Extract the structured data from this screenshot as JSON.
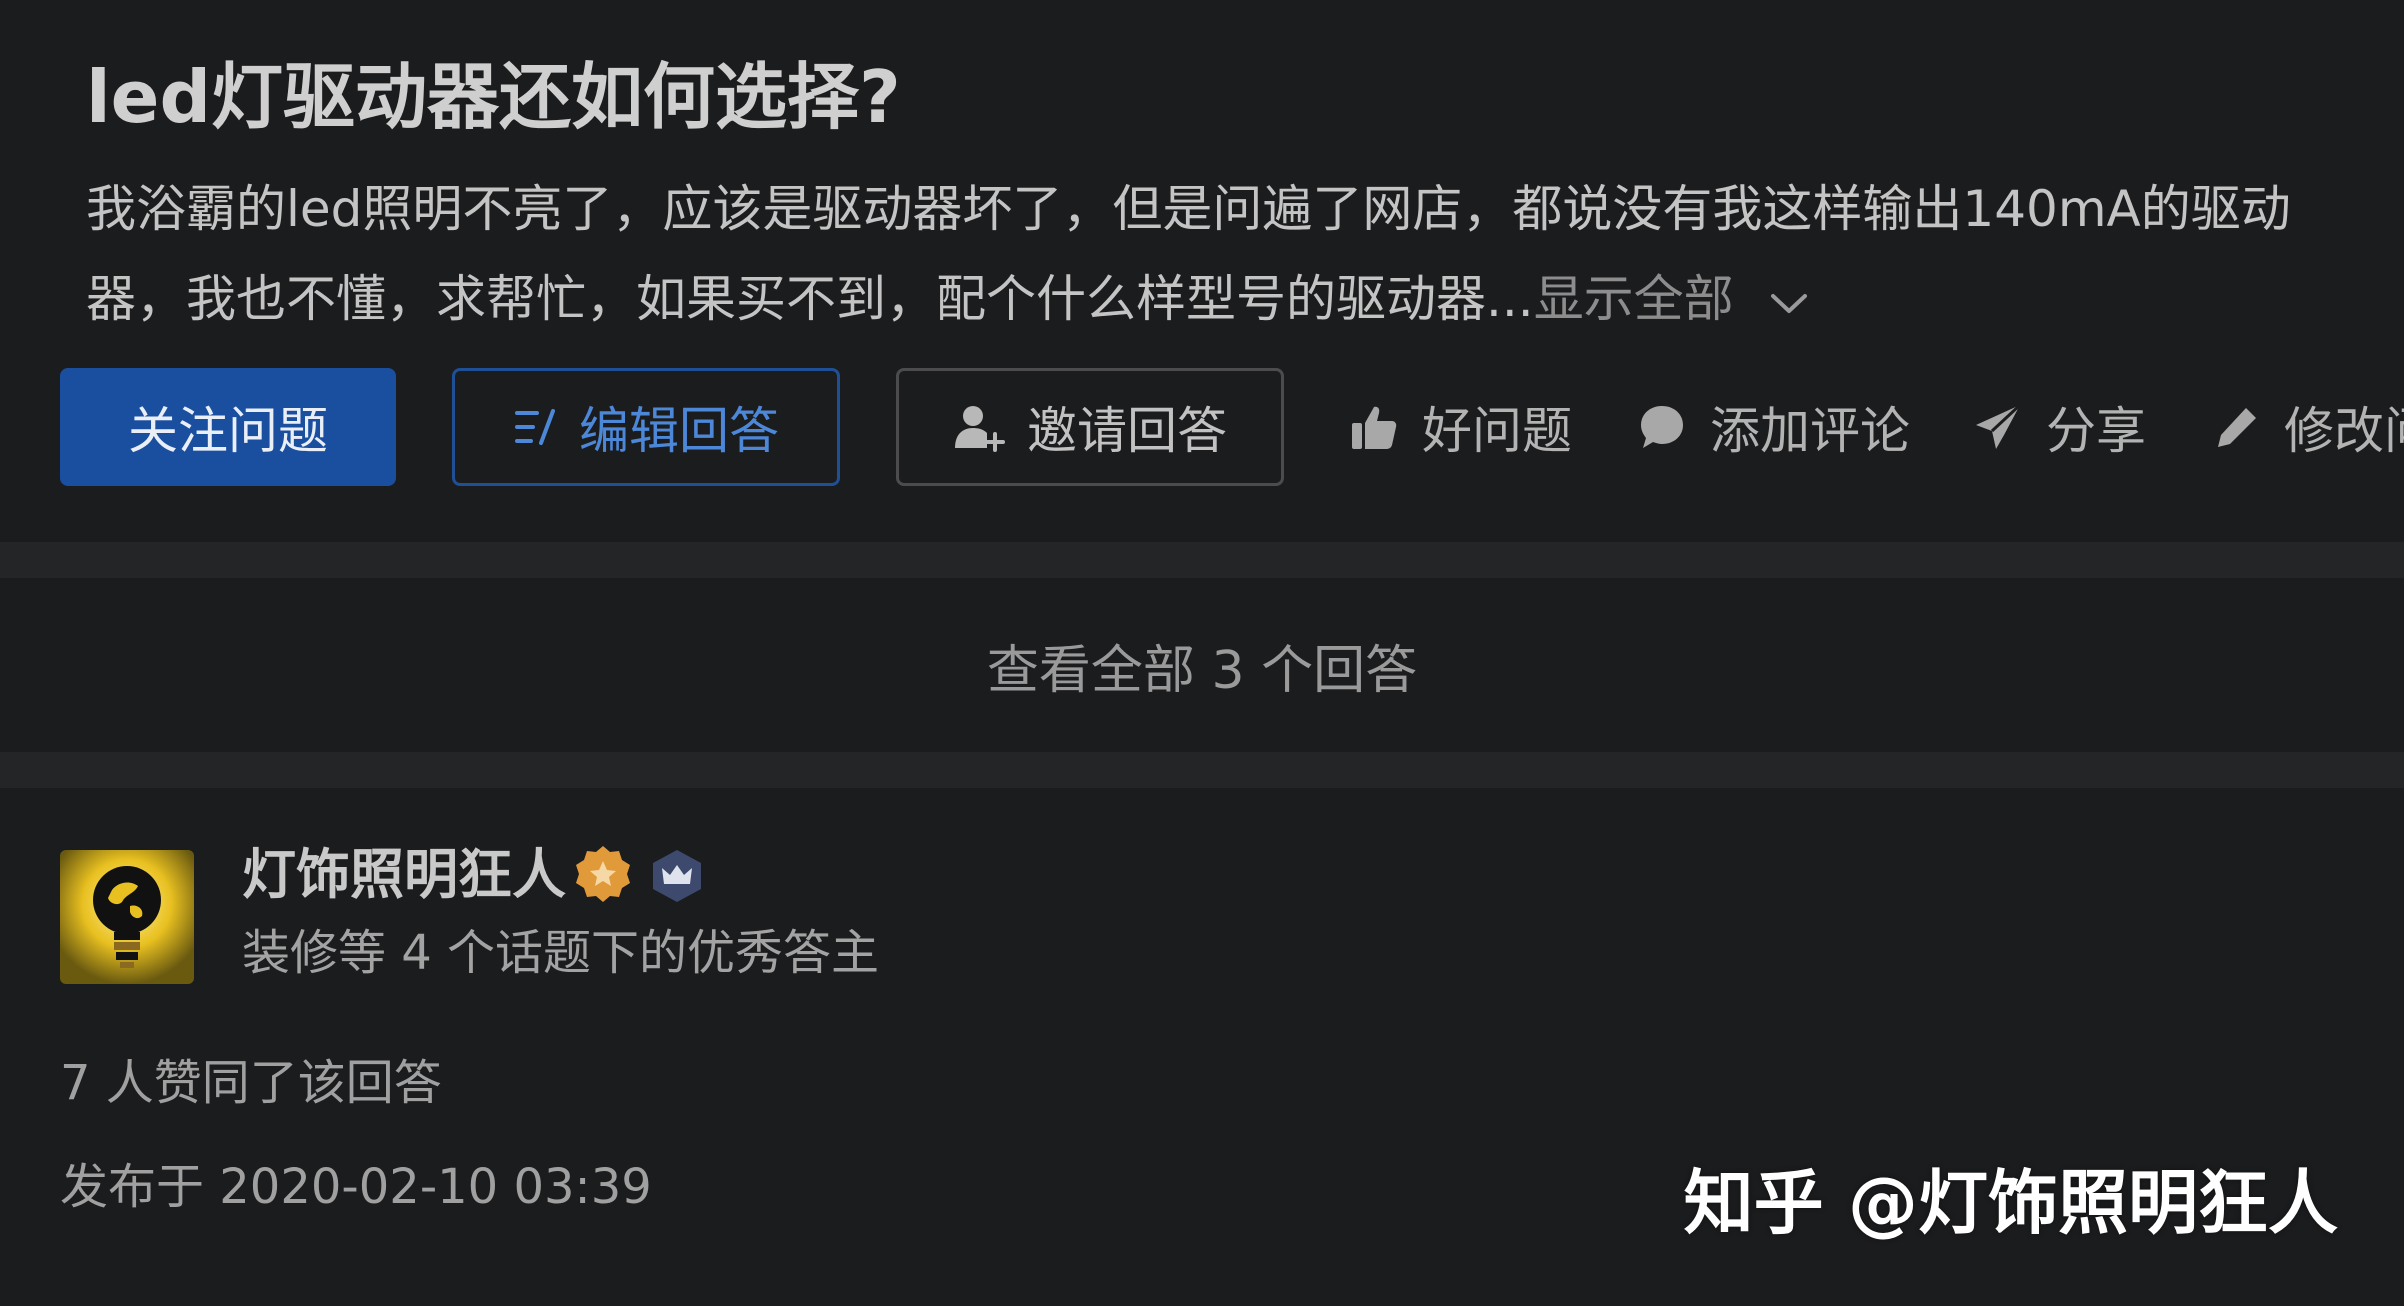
{
  "question": {
    "title": "led灯驱动器还如何选择?",
    "description_line1": "我浴霸的led照明不亮了，应该是驱动器坏了，但是问遍了网店，都说没有我这样输出140mA的驱动",
    "description_line2": "器，我也不懂，求帮忙，如果买不到，配个什么样型号的驱动器...",
    "show_all_label": "显示全部"
  },
  "actions": {
    "follow_label": "关注问题",
    "edit_label": "编辑回答",
    "invite_label": "邀请回答",
    "good_question_label": "好问题",
    "add_comment_label": "添加评论",
    "share_label": "分享",
    "modify_label": "修改问"
  },
  "view_all_answers": "查看全部 3 个回答",
  "answer": {
    "author_name": "灯饰照明狂人",
    "author_tag": "装修等 4 个话题下的优秀答主",
    "likes_text": "7 人赞同了该回答",
    "published_text": "发布于 2020-02-10 03:39"
  },
  "watermark": "知乎 @灯饰照明狂人",
  "colors": {
    "background": "#1b1c1e",
    "accent_blue": "#1a4fa0",
    "badge_orange": "#e09a3a"
  }
}
